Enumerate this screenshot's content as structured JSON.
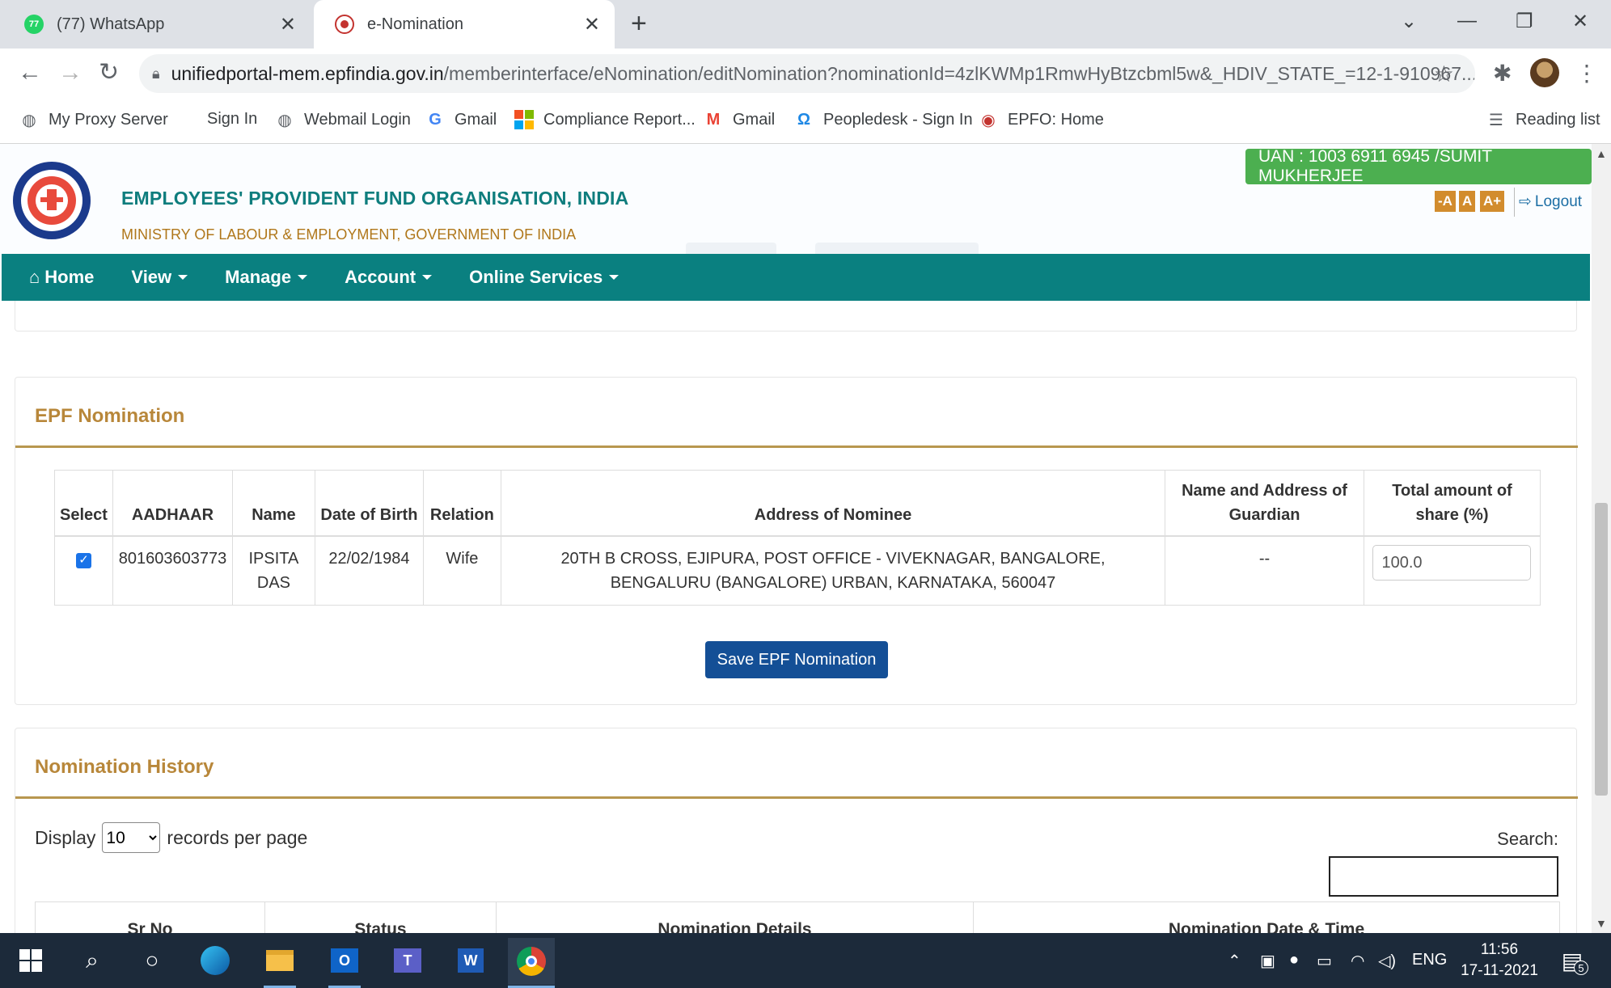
{
  "browser": {
    "tabs": [
      {
        "title": "(77) WhatsApp",
        "badge": "77",
        "active": false
      },
      {
        "title": "e-Nomination",
        "active": true
      }
    ],
    "url_host": "unifiedportal-mem.epfindia.gov.in",
    "url_path": "/memberinterface/eNomination/editNomination?nominationId=4zlKWMp1RmwHyBtzcbml5w&_HDIV_STATE_=12-1-910967...",
    "bookmarks": [
      {
        "label": "My Proxy Server",
        "icon": "globe-icon"
      },
      {
        "label": "Sign In",
        "icon": ""
      },
      {
        "label": "Webmail Login",
        "icon": "globe-icon"
      },
      {
        "label": "Gmail",
        "icon": "google-icon"
      },
      {
        "label": "Compliance Report...",
        "icon": "microsoft-icon"
      },
      {
        "label": "Gmail",
        "icon": "gmail-icon"
      },
      {
        "label": "Peopledesk - Sign In",
        "icon": "peopledesk-icon"
      },
      {
        "label": "EPFO: Home",
        "icon": "epfo-icon"
      }
    ],
    "reading_list": "Reading list"
  },
  "site": {
    "org_name": "EMPLOYEES' PROVIDENT FUND ORGANISATION, INDIA",
    "ministry": "MINISTRY OF LABOUR & EMPLOYMENT, GOVERNMENT OF INDIA",
    "uan": "UAN : 1003 6911 6945 /SUMIT MUKHERJEE",
    "font_controls": [
      "-A",
      "A",
      "A+"
    ],
    "logout": "Logout",
    "nav": [
      "Home",
      "View",
      "Manage",
      "Account",
      "Online Services"
    ]
  },
  "epf_nomination": {
    "title": "EPF Nomination",
    "headers": [
      "Select",
      "AADHAAR",
      "Name",
      "Date of Birth",
      "Relation",
      "Address of Nominee",
      "Name and Address of Guardian",
      "Total amount of share (%)"
    ],
    "rows": [
      {
        "selected": true,
        "aadhaar": "801603603773",
        "name": "IPSITA DAS",
        "dob": "22/02/1984",
        "relation": "Wife",
        "address": "20TH B CROSS, EJIPURA, POST OFFICE - VIVEKNAGAR, BANGALORE, BENGALURU (BANGALORE) URBAN, KARNATAKA, 560047",
        "guardian": "--",
        "share": "100.0"
      }
    ],
    "save_label": "Save EPF Nomination"
  },
  "nomination_history": {
    "title": "Nomination History",
    "display_label": "Display",
    "records_label": "records per page",
    "page_size": "10",
    "search_label": "Search:",
    "headers": [
      "Sr No",
      "Status",
      "Nomination Details",
      "Nomination Date & Time"
    ]
  },
  "taskbar": {
    "language": "ENG",
    "time": "11:56",
    "date": "17-11-2021",
    "notifications": "5"
  },
  "colors": {
    "teal_nav": "#0a8080",
    "uan_green": "#4caf50",
    "section_title": "#b8873a",
    "save_button": "#144f96"
  }
}
